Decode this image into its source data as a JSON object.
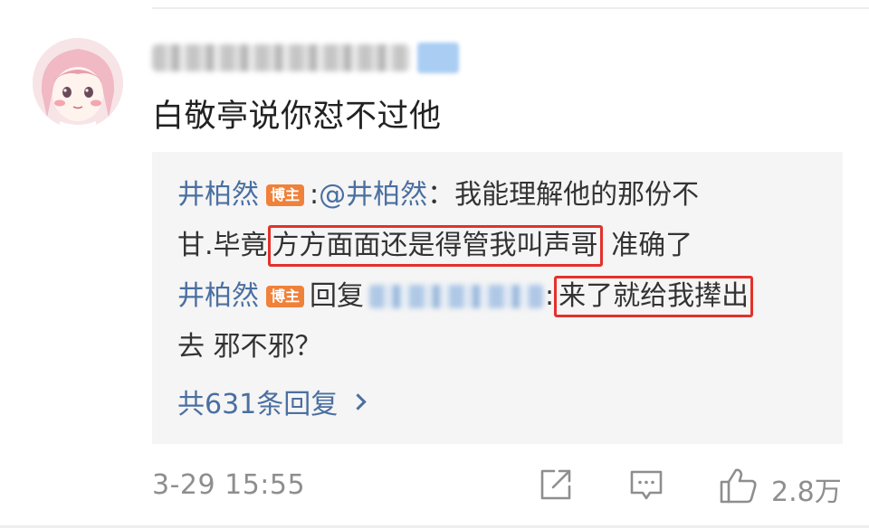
{
  "comment": {
    "text": "白敬亭说你怼不过他",
    "time": "3-29 15:55",
    "like_count": "2.8万"
  },
  "replies": [
    {
      "author": "井柏然",
      "badge": "博主",
      "mention": ":",
      "mention_name": "@井柏然",
      "text_first": "：我能理解他的那份不",
      "text_second_pre": "甘.毕竟",
      "text_highlight": "方方面面还是得管我叫声哥",
      "text_second_post": " 准确了"
    },
    {
      "author": "井柏然",
      "badge": "博主",
      "reply_word": "回复",
      "colon": ":",
      "text_highlight": "来了就给我撵出",
      "text_second": "去 邪不邪？"
    }
  ],
  "total_replies": "共631条回复",
  "colors": {
    "link_blue": "#4a6fa1",
    "badge_orange": "#f0813a",
    "highlight_red": "#e4312b",
    "meta_gray": "#8e8e8e",
    "reply_bg": "#f5f5f5"
  },
  "icons": [
    "share-icon",
    "comment-icon",
    "like-icon",
    "chevron-right-icon"
  ]
}
